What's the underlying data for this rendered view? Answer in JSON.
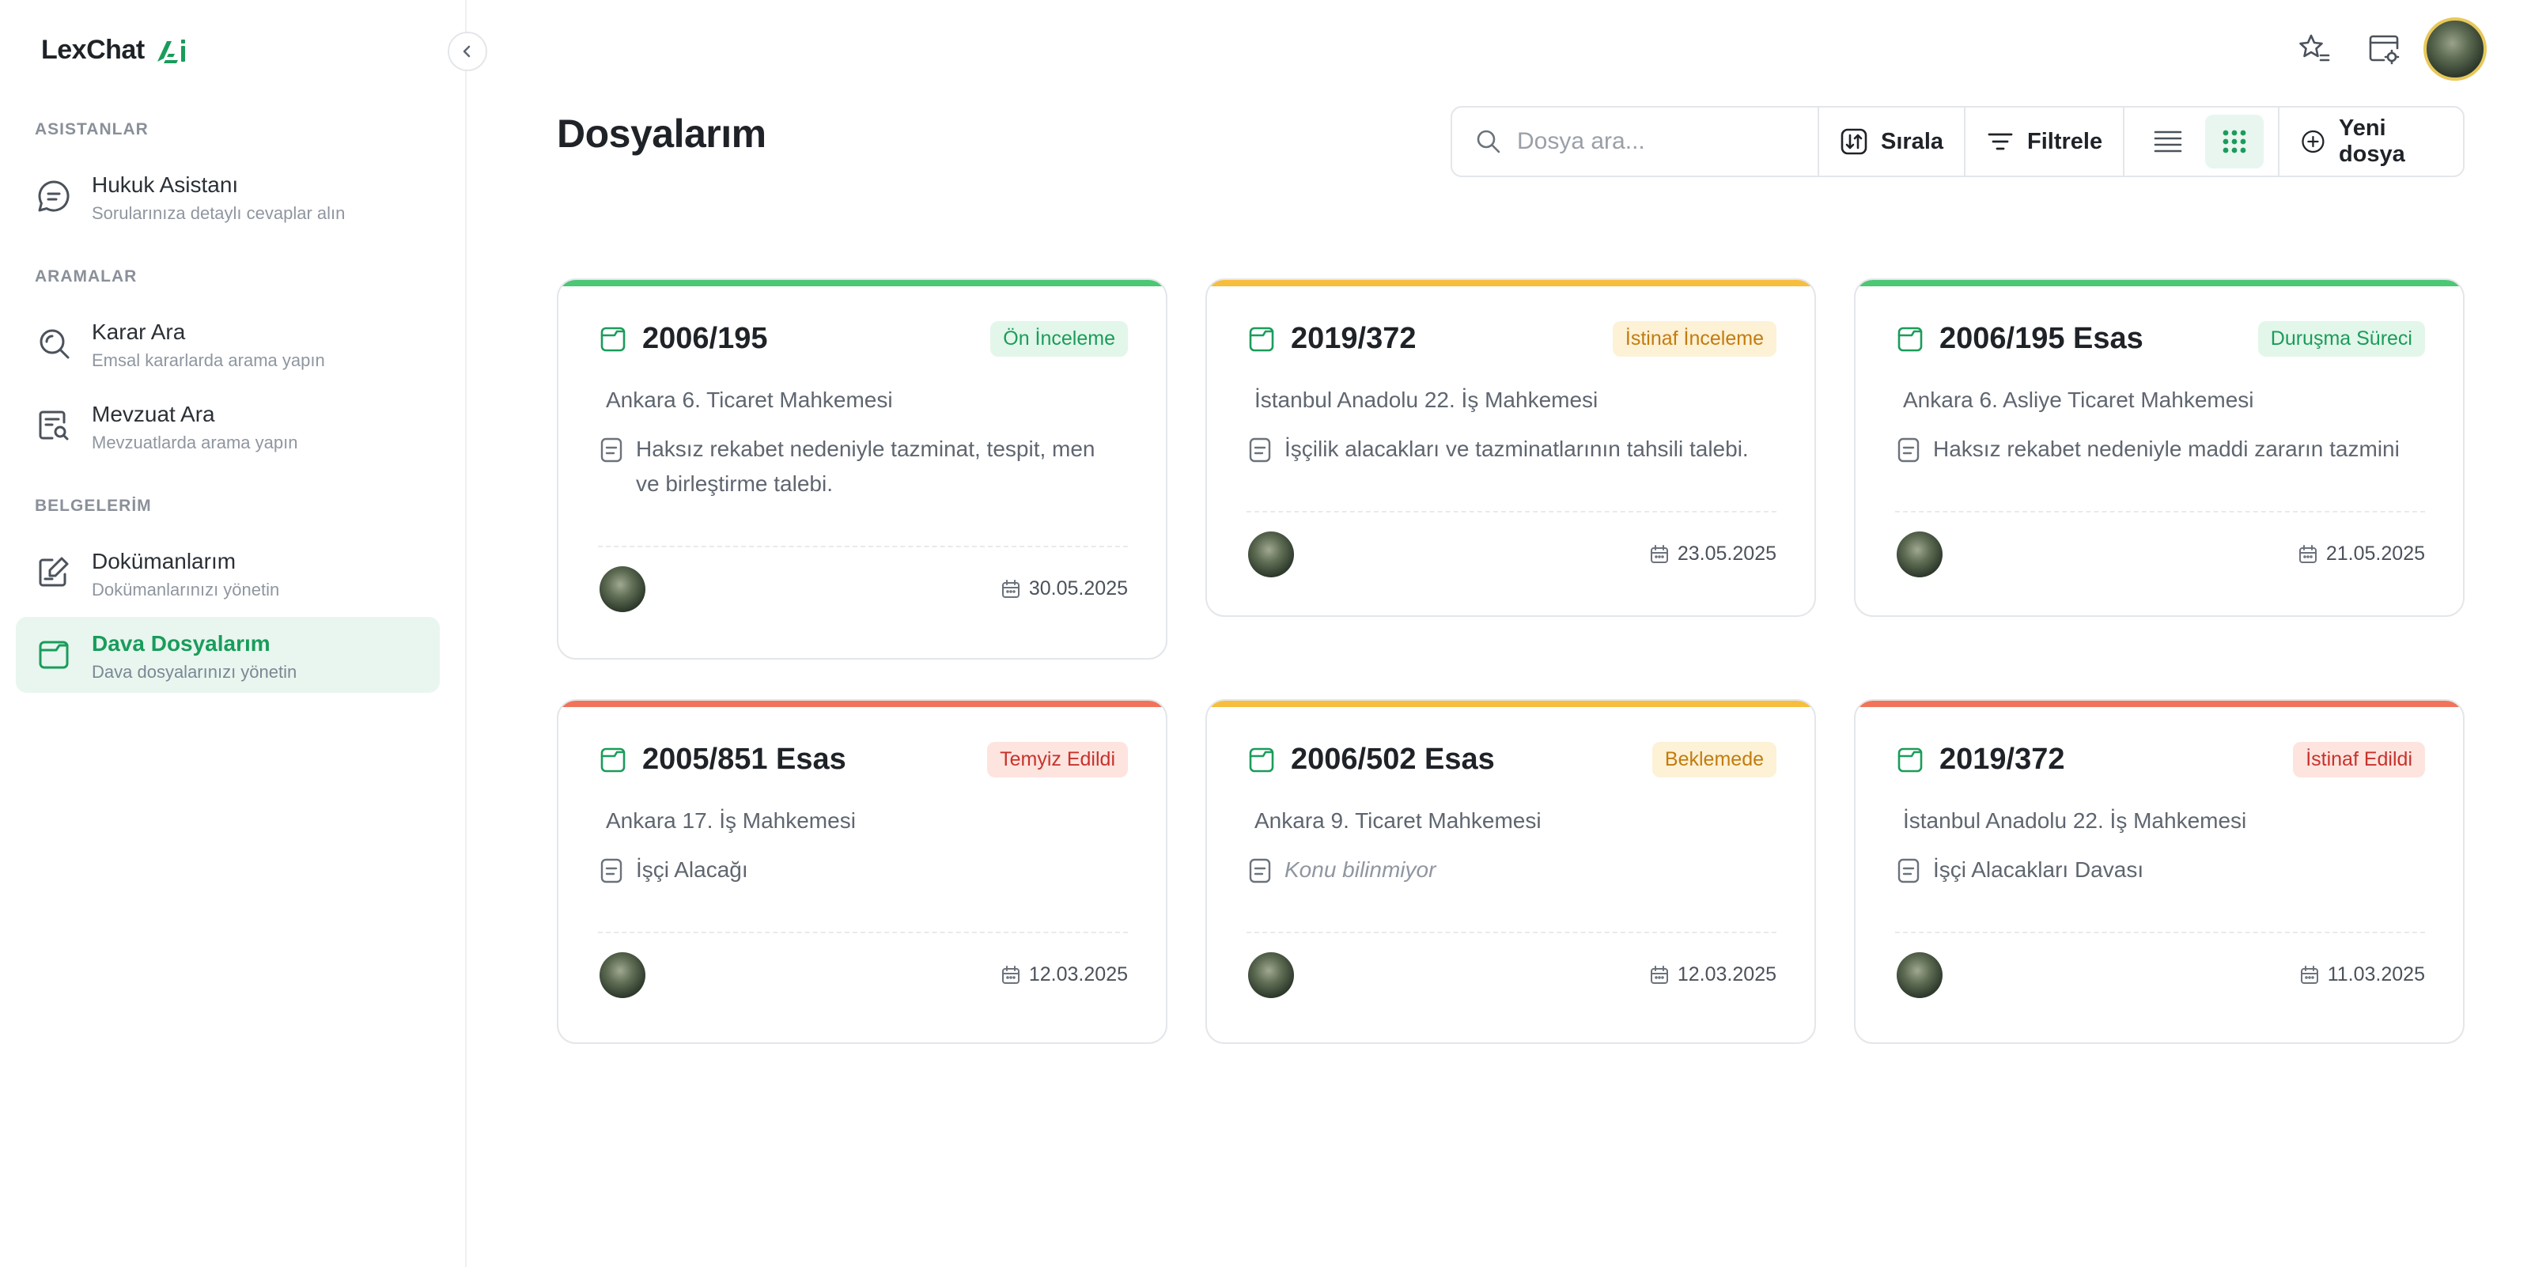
{
  "app": {
    "name": "LexChat"
  },
  "sidebar": {
    "sections": [
      {
        "title": "ASISTANLAR",
        "items": [
          {
            "label": "Hukuk Asistanı",
            "sub": "Sorularınıza detaylı cevaplar alın",
            "icon": "chat-bubble-icon"
          }
        ]
      },
      {
        "title": "ARAMALAR",
        "items": [
          {
            "label": "Karar Ara",
            "sub": "Emsal kararlarda arama yapın",
            "icon": "search-icon"
          },
          {
            "label": "Mevzuat Ara",
            "sub": "Mevzuatlarda arama yapın",
            "icon": "document-search-icon"
          }
        ]
      },
      {
        "title": "BELGELERİM",
        "items": [
          {
            "label": "Dokümanlarım",
            "sub": "Dokümanlarınızı yönetin",
            "icon": "document-edit-icon"
          },
          {
            "label": "Dava Dosyalarım",
            "sub": "Dava dosyalarınızı yönetin",
            "icon": "folder-icon",
            "active": true
          }
        ]
      }
    ]
  },
  "header": {
    "title": "Dosyalarım",
    "search_placeholder": "Dosya ara...",
    "sort_label": "Sırala",
    "filter_label": "Filtrele",
    "new_label": "Yeni dosya",
    "active_view": "grid"
  },
  "colors": {
    "accent": "#1a9c5b",
    "green_bar": "#4cc774",
    "yellow_bar": "#f7bd3d",
    "red_bar": "#f0735a"
  },
  "cards": [
    {
      "number": "2006/195",
      "status": "Ön İnceleme",
      "status_type": "green",
      "court": "Ankara 6. Ticaret Mahkemesi",
      "subject": "Haksız rekabet nedeniyle tazminat, tespit, men ve birleştirme talebi.",
      "date": "30.05.2025"
    },
    {
      "number": "2019/372",
      "status": "İstinaf İnceleme",
      "status_type": "yellow",
      "court": "İstanbul Anadolu 22. İş Mahkemesi",
      "subject": "İşçilik alacakları ve tazminatlarının tahsili talebi.",
      "date": "23.05.2025"
    },
    {
      "number": "2006/195 Esas",
      "status": "Duruşma Süreci",
      "status_type": "green",
      "court": "Ankara 6. Asliye Ticaret Mahkemesi",
      "subject": "Haksız rekabet nedeniyle maddi zararın tazmini",
      "date": "21.05.2025"
    },
    {
      "number": "2005/851 Esas",
      "status": "Temyiz Edildi",
      "status_type": "red",
      "court": "Ankara 17. İş Mahkemesi",
      "subject": "İşçi Alacağı",
      "date": "12.03.2025"
    },
    {
      "number": "2006/502 Esas",
      "status": "Beklemede",
      "status_type": "yellow",
      "court": "Ankara 9. Ticaret Mahkemesi",
      "subject": "Konu bilinmiyor",
      "subject_unknown": true,
      "date": "12.03.2025"
    },
    {
      "number": "2019/372",
      "status": "İstinaf Edildi",
      "status_type": "red",
      "court": "İstanbul Anadolu 22. İş Mahkemesi",
      "subject": "İşçi Alacakları Davası",
      "date": "11.03.2025"
    }
  ]
}
